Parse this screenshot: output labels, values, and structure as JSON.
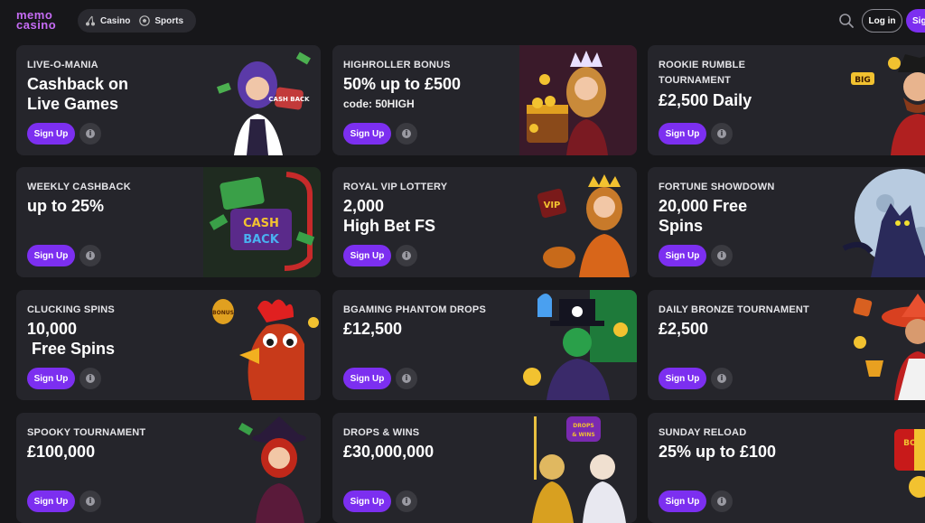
{
  "header": {
    "logo_line1": "memo",
    "logo_line2": "casino",
    "nav": [
      {
        "label": "Casino",
        "icon": "cherries-icon"
      },
      {
        "label": "Sports",
        "icon": "soccer-ball-icon"
      }
    ],
    "search_icon": "search-icon",
    "login_label": "Log in",
    "signup_label": "Sign"
  },
  "colors": {
    "accent": "#7c2ff0",
    "logo": "#c66cf5",
    "card_bg": "#25252b",
    "page_bg": "#17171a"
  },
  "cards": [
    {
      "category": "LIVE-O-MANIA",
      "headline": "Cashback on\nLive Games",
      "code": "",
      "button": "Sign Up",
      "art": "dealer-girl-cashback",
      "art_text": "CASH BACK"
    },
    {
      "category": "HIGHROLLER BONUS",
      "headline": "50% up to £500",
      "code": "code: 50HIGH",
      "button": "Sign Up",
      "art": "queen-treasure-chest",
      "art_text": ""
    },
    {
      "category": "ROOKIE RUMBLE\nTOURNAMENT",
      "headline": "£2,500 Daily",
      "code": "",
      "button": "Sign Up",
      "art": "pirate-big-win",
      "art_text": "BIG"
    },
    {
      "category": "WEEKLY CASHBACK",
      "headline": "up to 25%",
      "code": "",
      "button": "Sign Up",
      "art": "cashback-money-sign",
      "art_text": "CASH BACK"
    },
    {
      "category": "ROYAL VIP LOTTERY",
      "headline": "2,000\nHigh Bet FS",
      "code": "",
      "button": "Sign Up",
      "art": "vip-princess",
      "art_text": "VIP"
    },
    {
      "category": "FORTUNE SHOWDOWN",
      "headline": "20,000 Free\nSpins",
      "code": "",
      "button": "Sign Up",
      "art": "werewolf-moon",
      "art_text": ""
    },
    {
      "category": "CLUCKING SPINS",
      "headline": "10,000\n Free Spins",
      "code": "",
      "button": "Sign Up",
      "art": "rooster-bonus",
      "art_text": "BONUS"
    },
    {
      "category": "BGAMING PHANTOM DROPS",
      "headline": "£12,500",
      "code": "",
      "button": "Sign Up",
      "art": "phantom-skull-hat",
      "art_text": ""
    },
    {
      "category": "DAILY BRONZE TOURNAMENT",
      "headline": "£2,500",
      "code": "",
      "button": "Sign Up",
      "art": "mariachi-trophy",
      "art_text": ""
    },
    {
      "category": "SPOOKY TOURNAMENT",
      "headline": "£100,000",
      "code": "",
      "button": "Sign Up",
      "art": "witch-redhead",
      "art_text": ""
    },
    {
      "category": "DROPS & WINS",
      "headline": "£30,000,000",
      "code": "",
      "button": "Sign Up",
      "art": "zeus-drops-wins",
      "art_text": "DROPS & WINS"
    },
    {
      "category": "SUNDAY RELOAD",
      "headline": "25% up to £100",
      "code": "",
      "button": "Sign Up",
      "art": "bonus-gift-box",
      "art_text": "BONUS"
    }
  ]
}
